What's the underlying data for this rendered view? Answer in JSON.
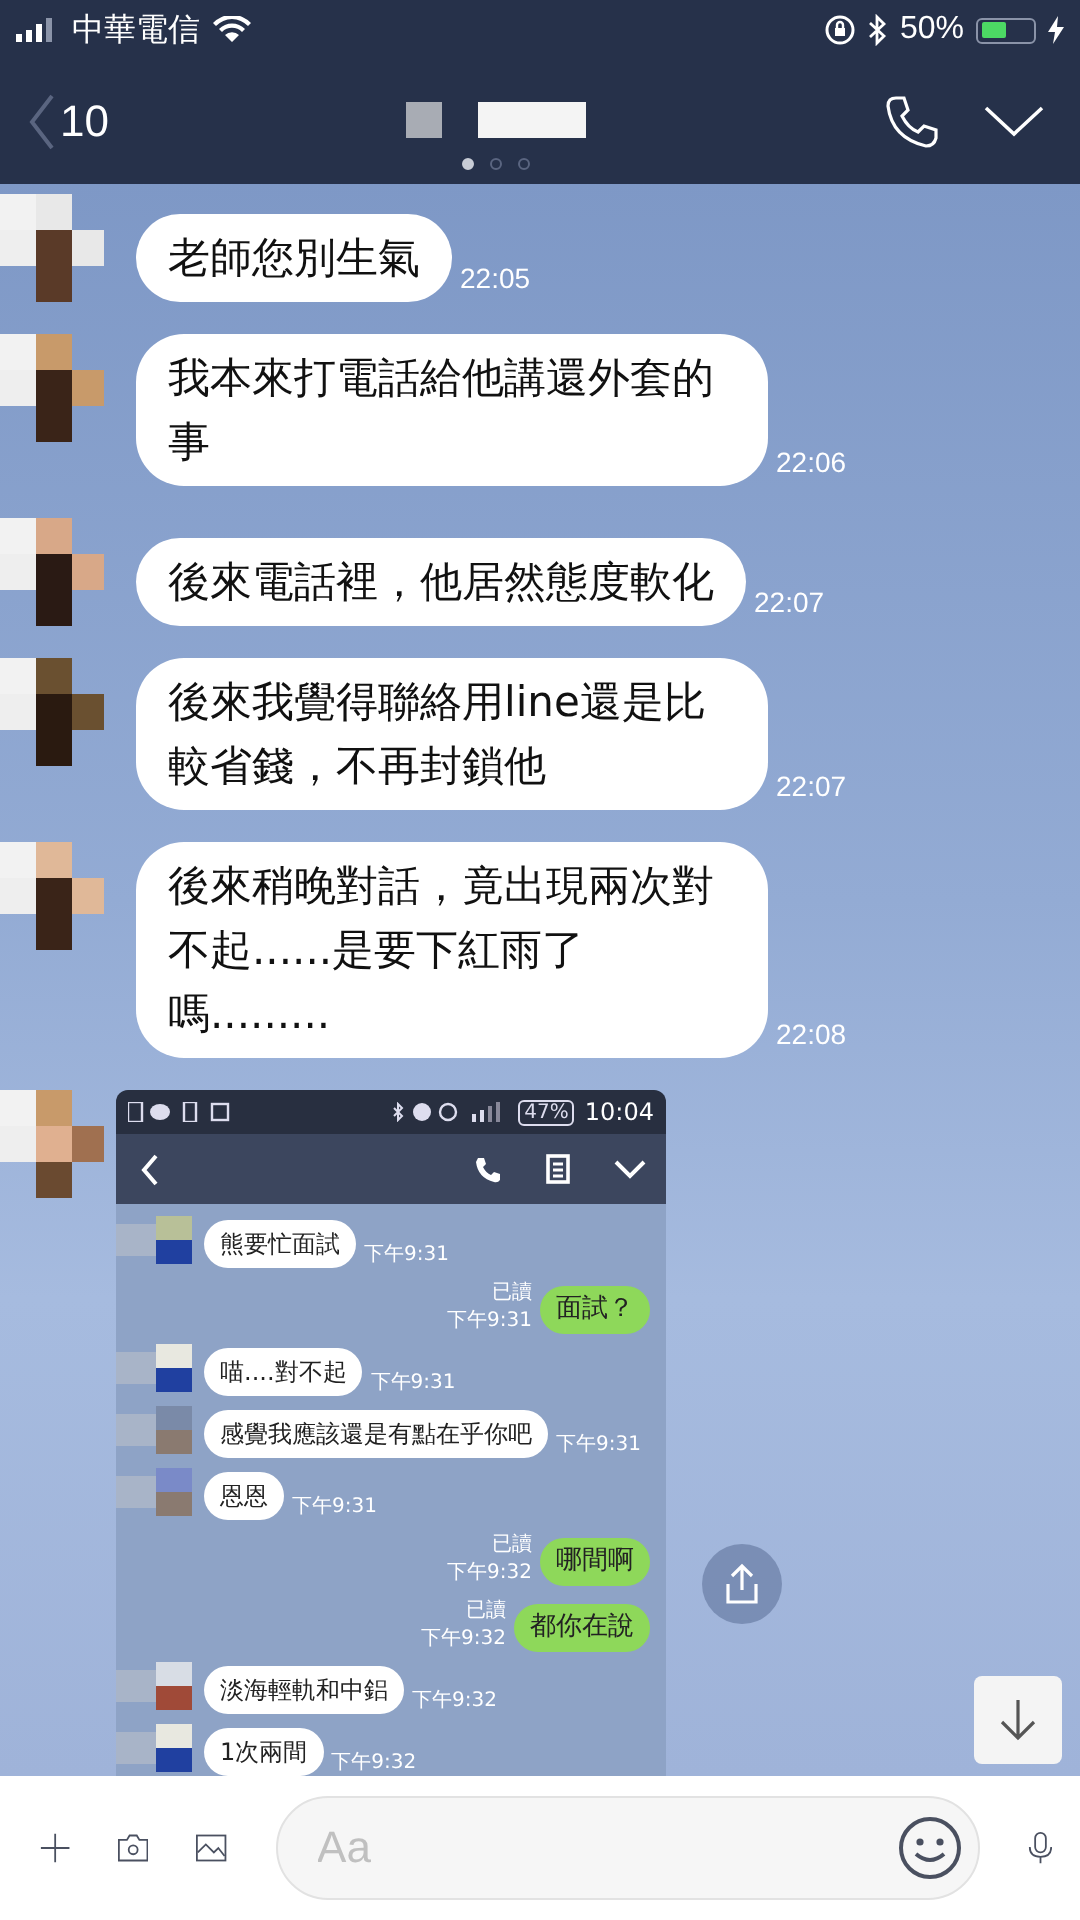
{
  "status_bar": {
    "carrier": "中華電信",
    "battery": "50%"
  },
  "header": {
    "back_count": "10",
    "page_dots": [
      {
        "selected": true
      },
      {
        "selected": false
      },
      {
        "selected": false
      }
    ]
  },
  "messages": [
    {
      "text": "老師您別生氣",
      "time": "22:05"
    },
    {
      "text": "我本來打電話給他講還外套的事",
      "time": "22:06"
    },
    {
      "text": "後來電話裡，他居然態度軟化",
      "time": "22:07"
    },
    {
      "text": "後來我覺得聯絡用line還是比較省錢，不再封鎖他",
      "time": "22:07"
    },
    {
      "text": "後來稍晚對話，竟出現兩次對不起......是要下紅雨了嗎.........",
      "time": "22:08"
    }
  ],
  "image_message": {
    "status_bar": {
      "battery": "47%",
      "time": "10:04"
    },
    "messages": [
      {
        "kind": "received",
        "text": "熊要忙面試",
        "time": "下午9:31"
      },
      {
        "kind": "sent",
        "text": "面試？",
        "time": "下午9:31",
        "read": "已讀"
      },
      {
        "kind": "received",
        "text": "喵....對不起",
        "time": "下午9:31"
      },
      {
        "kind": "received",
        "text": "感覺我應該還是有點在乎你吧",
        "time": "下午9:31"
      },
      {
        "kind": "received",
        "text": "恩恩",
        "time": "下午9:31"
      },
      {
        "kind": "sent",
        "text": "哪間啊",
        "time": "下午9:32",
        "read": "已讀"
      },
      {
        "kind": "sent",
        "text": "都你在說",
        "time": "下午9:32",
        "read": "已讀"
      },
      {
        "kind": "received",
        "text": "淡海輕軌和中鋁",
        "time": "下午9:32"
      },
      {
        "kind": "received",
        "text": "1次兩間",
        "time": "下午9:32"
      }
    ]
  },
  "input": {
    "placeholder": "Aa"
  }
}
